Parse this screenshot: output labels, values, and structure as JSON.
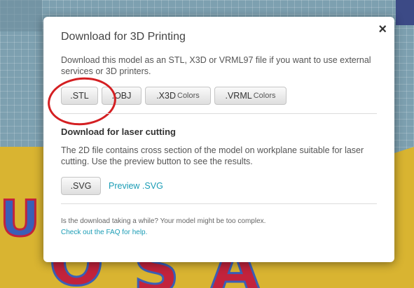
{
  "background": {
    "letters": [
      "O",
      "S",
      "A",
      "U"
    ]
  },
  "modal": {
    "title": "Download for 3D Printing",
    "close_label": "×",
    "description": "Download this model as an STL, X3D or VRML97 file if you want to use external services or 3D printers.",
    "buttons": {
      "stl": ".STL",
      "obj": ".OBJ",
      "x3d": ".X3D",
      "x3d_suffix": "Colors",
      "vrml": ".VRML",
      "vrml_suffix": "Colors"
    },
    "laser": {
      "title": "Download for laser cutting",
      "description": "The 2D file contains cross section of the model on workplane suitable for laser cutting. Use the preview button to see the results.",
      "svg_label": ".SVG",
      "preview_label": "Preview .SVG"
    },
    "footer": {
      "note": "Is the download taking a while? Your model might be too complex.",
      "faq_link": "Check out the FAQ for help."
    }
  },
  "colors": {
    "link": "#1a9cb5",
    "annotation_circle": "#d41f22",
    "model_yellow": "#d9b431",
    "model_red": "#c2233c",
    "model_blue": "#3a5fb6"
  }
}
